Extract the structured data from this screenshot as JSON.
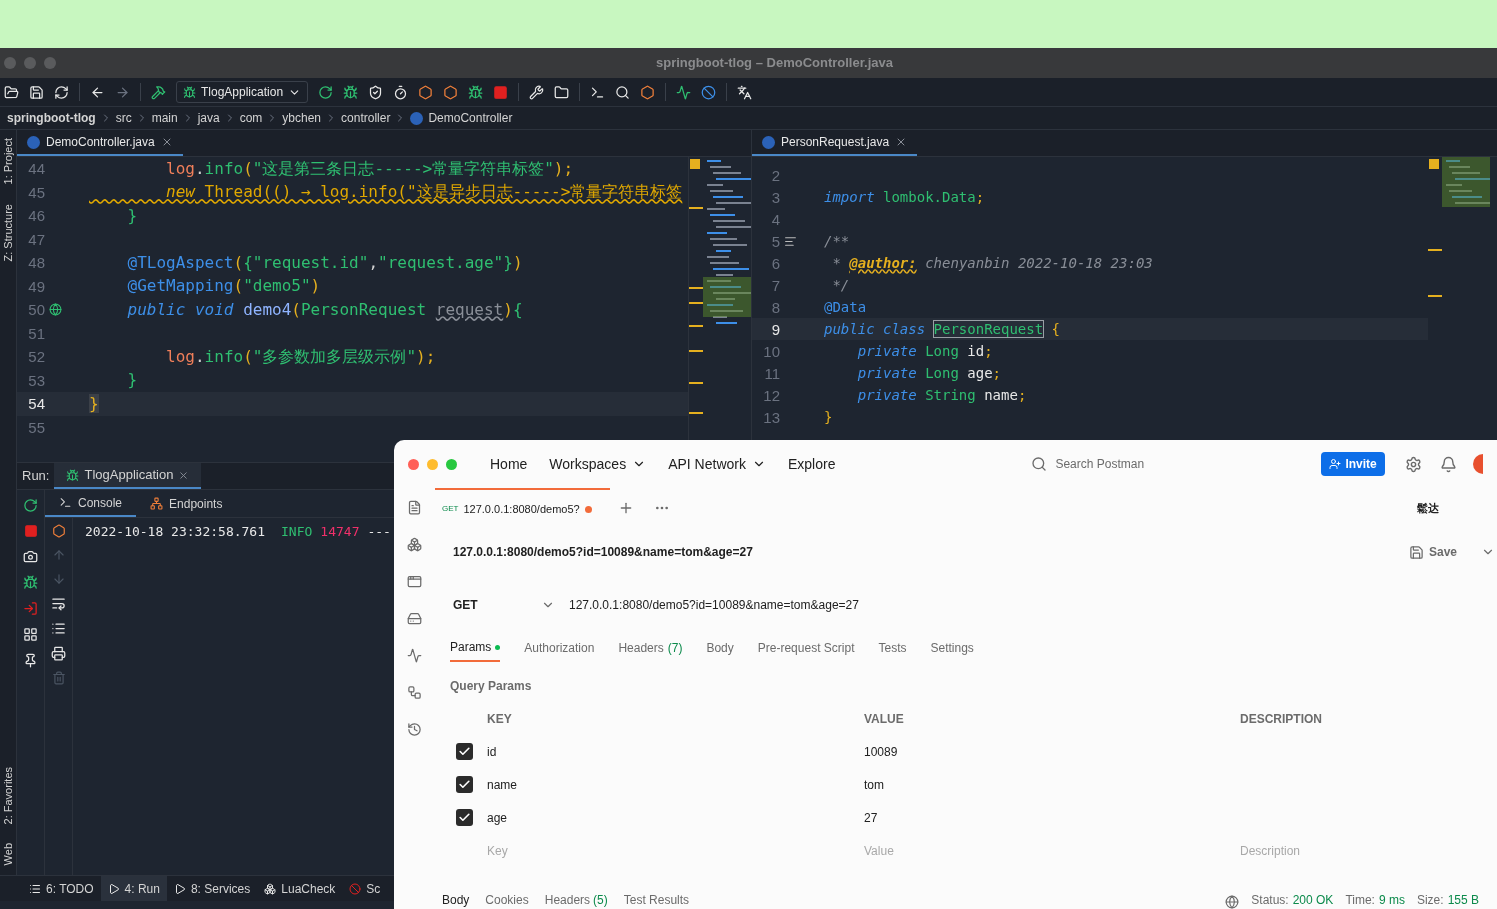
{
  "ide": {
    "window_title": "springboot-tlog – DemoController.java",
    "run_config": "TlogApplication",
    "breadcrumbs": [
      "springboot-tlog",
      "src",
      "main",
      "java",
      "com",
      "ybchen",
      "controller",
      "DemoController"
    ],
    "stripe_top": [
      "1: Project",
      "Z: Structure"
    ],
    "stripe_bottom": [
      "2: Favorites",
      "Web"
    ],
    "left_editor": {
      "tab": {
        "label": "DemoController.java",
        "selected": true
      },
      "lines": [
        {
          "number": "44",
          "current": false,
          "tokens": [
            {
              "text": "        log",
              "kind": "fld"
            },
            {
              "text": ".",
              "kind": "plain"
            },
            {
              "text": "info",
              "kind": "fn"
            },
            {
              "text": "(",
              "kind": "br"
            },
            {
              "text": "\"这是第三条日志----->常量字符串标签\"",
              "kind": "str"
            },
            {
              "text": ");",
              "kind": "br"
            }
          ]
        },
        {
          "number": "45",
          "current": false,
          "tokens": [
            {
              "text": "        new",
              "kind": "warnkw"
            },
            {
              "text": " Thread(() → log.info(\"这是异步日志----->常量字符串标签",
              "kind": "warn"
            }
          ]
        },
        {
          "number": "46",
          "current": false,
          "tokens": [
            {
              "text": "    }",
              "kind": "fn"
            }
          ]
        },
        {
          "number": "47",
          "current": false
        },
        {
          "number": "48",
          "current": false,
          "tokens": [
            {
              "text": "    @TLogAspect",
              "kind": "ann"
            },
            {
              "text": "(",
              "kind": "br"
            },
            {
              "text": "{",
              "kind": "fn"
            },
            {
              "text": "\"request.id\"",
              "kind": "str"
            },
            {
              "text": ",",
              "kind": "plain"
            },
            {
              "text": "\"request.age\"",
              "kind": "str"
            },
            {
              "text": "}",
              "kind": "fn"
            },
            {
              "text": ")",
              "kind": "br"
            }
          ]
        },
        {
          "number": "49",
          "current": false,
          "tokens": [
            {
              "text": "    @GetMapping",
              "kind": "ann"
            },
            {
              "text": "(",
              "kind": "br"
            },
            {
              "text": "\"demo5\"",
              "kind": "str"
            },
            {
              "text": ")",
              "kind": "br"
            }
          ]
        },
        {
          "number": "50",
          "current": false,
          "gutter": {
            "kind": "globe"
          },
          "tokens": [
            {
              "text": "    public void ",
              "kind": "kw"
            },
            {
              "text": "demo4",
              "kind": "decl"
            },
            {
              "text": "(",
              "kind": "br"
            },
            {
              "text": "PersonRequest ",
              "kind": "type"
            },
            {
              "text": "request",
              "kind": "unused"
            },
            {
              "text": ")",
              "kind": "br"
            },
            {
              "text": "{",
              "kind": "fn"
            }
          ]
        },
        {
          "number": "51",
          "current": false
        },
        {
          "number": "52",
          "current": false,
          "tokens": [
            {
              "text": "        log",
              "kind": "fld"
            },
            {
              "text": ".",
              "kind": "plain"
            },
            {
              "text": "info",
              "kind": "fn"
            },
            {
              "text": "(",
              "kind": "br"
            },
            {
              "text": "\"多参数加多层级示例\"",
              "kind": "str"
            },
            {
              "text": ");",
              "kind": "br"
            }
          ]
        },
        {
          "number": "53",
          "current": false,
          "tokens": [
            {
              "text": "    }",
              "kind": "fn"
            }
          ]
        },
        {
          "number": "54",
          "current": true,
          "tokens": [
            {
              "text": "}",
              "kind": "brbox"
            }
          ]
        },
        {
          "number": "55",
          "current": false
        }
      ]
    },
    "right_editor": {
      "tab": {
        "label": "PersonRequest.java",
        "selected": true
      },
      "lines": [
        {
          "number": "2",
          "current": false
        },
        {
          "number": "3",
          "current": false,
          "tokens": [
            {
              "text": "import ",
              "kind": "kw"
            },
            {
              "text": "lombok.Data",
              "kind": "type"
            },
            {
              "text": ";",
              "kind": "br"
            }
          ]
        },
        {
          "number": "4",
          "current": false
        },
        {
          "number": "5",
          "current": false,
          "gutter": {
            "kind": "doc"
          },
          "tokens": [
            {
              "text": "/**",
              "kind": "cmt"
            }
          ]
        },
        {
          "number": "6",
          "current": false,
          "tokens": [
            {
              "text": " * ",
              "kind": "cmt"
            },
            {
              "text": "@author:",
              "kind": "tag"
            },
            {
              "text": " chenyanbin 2022-10-18 23:03",
              "kind": "cmt"
            }
          ]
        },
        {
          "number": "7",
          "current": false,
          "tokens": [
            {
              "text": " */",
              "kind": "cmt"
            }
          ]
        },
        {
          "number": "8",
          "current": false,
          "tokens": [
            {
              "text": "@Data",
              "kind": "ann"
            }
          ]
        },
        {
          "number": "9",
          "current": true,
          "tokens": [
            {
              "text": "public class ",
              "kind": "kw"
            },
            {
              "text": "PersonRequest",
              "kind": "typebox"
            },
            {
              "text": " {",
              "kind": "br"
            }
          ]
        },
        {
          "number": "10",
          "current": false,
          "tokens": [
            {
              "text": "    private ",
              "kind": "kw"
            },
            {
              "text": "Long",
              "kind": "type"
            },
            {
              "text": " id",
              "kind": "white"
            },
            {
              "text": ";",
              "kind": "br"
            }
          ]
        },
        {
          "number": "11",
          "current": false,
          "tokens": [
            {
              "text": "    private ",
              "kind": "kw"
            },
            {
              "text": "Long",
              "kind": "type"
            },
            {
              "text": " age",
              "kind": "white"
            },
            {
              "text": ";",
              "kind": "br"
            }
          ]
        },
        {
          "number": "12",
          "current": false,
          "tokens": [
            {
              "text": "    private ",
              "kind": "kw"
            },
            {
              "text": "String",
              "kind": "type"
            },
            {
              "text": " name",
              "kind": "white"
            },
            {
              "text": ";",
              "kind": "br"
            }
          ]
        },
        {
          "number": "13",
          "current": false,
          "tokens": [
            {
              "text": "}",
              "kind": "br"
            }
          ]
        }
      ]
    },
    "run_panel": {
      "label": "Run:",
      "tab": "TlogApplication",
      "subtabs": [
        {
          "label": "Console",
          "selected": true
        },
        {
          "label": "Endpoints",
          "selected": false
        }
      ],
      "console": [
        {
          "text": "2022-10-18 23:32:58.761",
          "kind": "time"
        },
        {
          "text": "INFO",
          "kind": "level"
        },
        {
          "text": "14747",
          "kind": "pid"
        },
        {
          "text": "---",
          "kind": "plain"
        }
      ]
    },
    "bottom_tabs": [
      {
        "label": "6: TODO",
        "selected": false
      },
      {
        "label": "4: Run",
        "selected": true
      },
      {
        "label": "8: Services",
        "selected": false
      },
      {
        "label": "LuaCheck",
        "selected": false
      },
      {
        "label": "Sc",
        "selected": false
      }
    ]
  },
  "postman": {
    "nav": [
      {
        "label": "Home",
        "dropdown": false
      },
      {
        "label": "Workspaces",
        "dropdown": true
      },
      {
        "label": "API Network",
        "dropdown": true
      },
      {
        "label": "Explore",
        "dropdown": false
      }
    ],
    "search_placeholder": "Search Postman",
    "invite": "Invite",
    "request_tab": {
      "method": "GET",
      "label": "127.0.0.1:8080/demo5?",
      "unsaved": true
    },
    "user": "鬆达",
    "request_name": "127.0.0.1:8080/demo5?id=10089&name=tom&age=27",
    "save": "Save",
    "method": "GET",
    "url": "127.0.0.1:8080/demo5?id=10089&name=tom&age=27",
    "tabs": [
      {
        "label": "Params",
        "selected": true,
        "dot": true
      },
      {
        "label": "Authorization",
        "selected": false,
        "dot": false
      },
      {
        "label": "Headers",
        "count": "(7)",
        "selected": false,
        "dot": false
      },
      {
        "label": "Body",
        "selected": false,
        "dot": false
      },
      {
        "label": "Pre-request Script",
        "selected": false,
        "dot": false
      },
      {
        "label": "Tests",
        "selected": false,
        "dot": false
      },
      {
        "label": "Settings",
        "selected": false,
        "dot": false
      }
    ],
    "section": "Query Params",
    "columns": [
      "KEY",
      "VALUE",
      "DESCRIPTION"
    ],
    "params": [
      {
        "key": "id",
        "value": "10089",
        "checked": true
      },
      {
        "key": "name",
        "value": "tom",
        "checked": true
      },
      {
        "key": "age",
        "value": "27",
        "checked": true
      }
    ],
    "new_row": {
      "key_placeholder": "Key",
      "value_placeholder": "Value",
      "description_placeholder": "Description"
    },
    "response": {
      "tabs": [
        {
          "label": "Body",
          "selected": true
        },
        {
          "label": "Cookies",
          "selected": false
        },
        {
          "label": "Headers",
          "count": "(5)",
          "selected": false
        },
        {
          "label": "Test Results",
          "selected": false
        }
      ],
      "status_label": "Status:",
      "status": "200 OK",
      "time_label": "Time:",
      "time": "9 ms",
      "size_label": "Size:",
      "size": "155 B"
    }
  }
}
